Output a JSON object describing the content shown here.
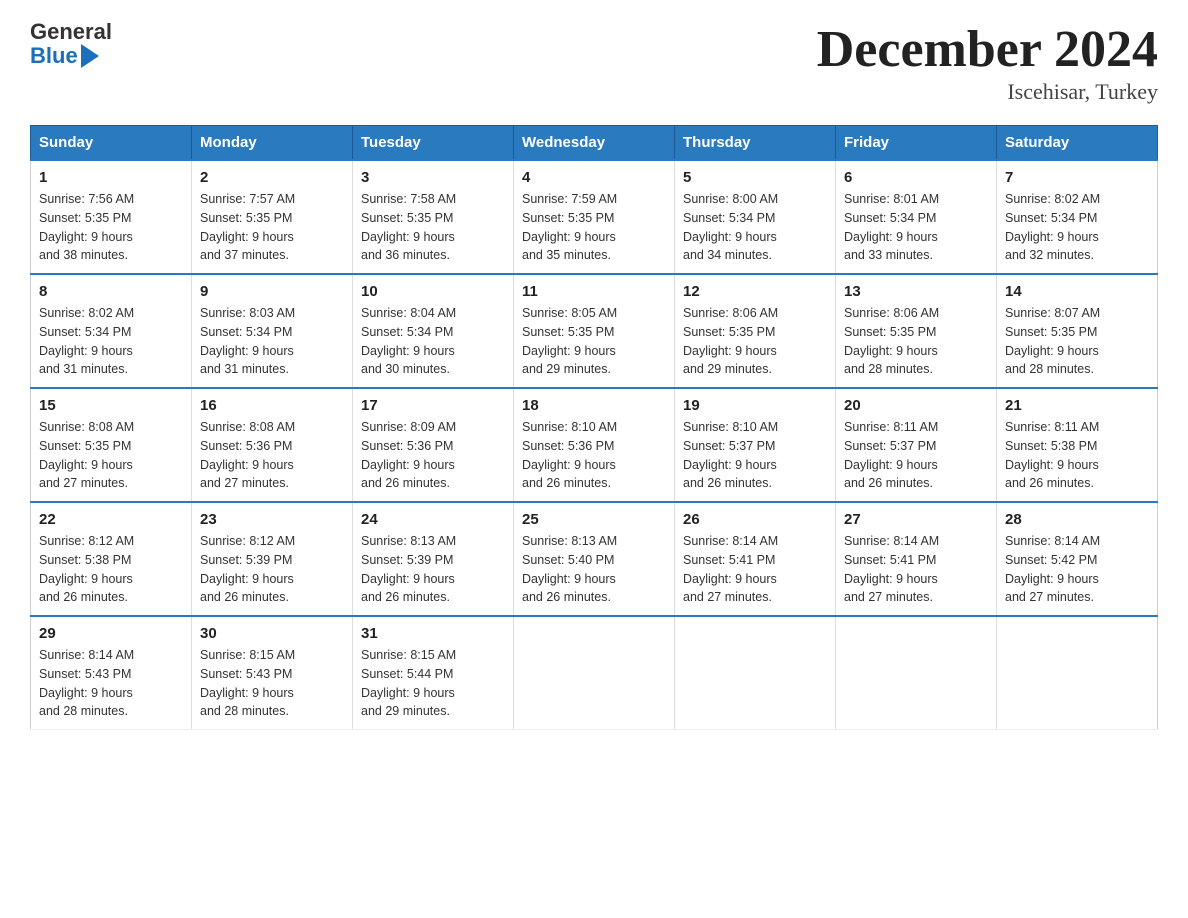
{
  "header": {
    "logo_general": "General",
    "logo_blue": "Blue",
    "month_title": "December 2024",
    "location": "Iscehisar, Turkey"
  },
  "days_of_week": [
    "Sunday",
    "Monday",
    "Tuesday",
    "Wednesday",
    "Thursday",
    "Friday",
    "Saturday"
  ],
  "weeks": [
    [
      {
        "day": "1",
        "sunrise": "7:56 AM",
        "sunset": "5:35 PM",
        "daylight": "9 hours and 38 minutes."
      },
      {
        "day": "2",
        "sunrise": "7:57 AM",
        "sunset": "5:35 PM",
        "daylight": "9 hours and 37 minutes."
      },
      {
        "day": "3",
        "sunrise": "7:58 AM",
        "sunset": "5:35 PM",
        "daylight": "9 hours and 36 minutes."
      },
      {
        "day": "4",
        "sunrise": "7:59 AM",
        "sunset": "5:35 PM",
        "daylight": "9 hours and 35 minutes."
      },
      {
        "day": "5",
        "sunrise": "8:00 AM",
        "sunset": "5:34 PM",
        "daylight": "9 hours and 34 minutes."
      },
      {
        "day": "6",
        "sunrise": "8:01 AM",
        "sunset": "5:34 PM",
        "daylight": "9 hours and 33 minutes."
      },
      {
        "day": "7",
        "sunrise": "8:02 AM",
        "sunset": "5:34 PM",
        "daylight": "9 hours and 32 minutes."
      }
    ],
    [
      {
        "day": "8",
        "sunrise": "8:02 AM",
        "sunset": "5:34 PM",
        "daylight": "9 hours and 31 minutes."
      },
      {
        "day": "9",
        "sunrise": "8:03 AM",
        "sunset": "5:34 PM",
        "daylight": "9 hours and 31 minutes."
      },
      {
        "day": "10",
        "sunrise": "8:04 AM",
        "sunset": "5:34 PM",
        "daylight": "9 hours and 30 minutes."
      },
      {
        "day": "11",
        "sunrise": "8:05 AM",
        "sunset": "5:35 PM",
        "daylight": "9 hours and 29 minutes."
      },
      {
        "day": "12",
        "sunrise": "8:06 AM",
        "sunset": "5:35 PM",
        "daylight": "9 hours and 29 minutes."
      },
      {
        "day": "13",
        "sunrise": "8:06 AM",
        "sunset": "5:35 PM",
        "daylight": "9 hours and 28 minutes."
      },
      {
        "day": "14",
        "sunrise": "8:07 AM",
        "sunset": "5:35 PM",
        "daylight": "9 hours and 28 minutes."
      }
    ],
    [
      {
        "day": "15",
        "sunrise": "8:08 AM",
        "sunset": "5:35 PM",
        "daylight": "9 hours and 27 minutes."
      },
      {
        "day": "16",
        "sunrise": "8:08 AM",
        "sunset": "5:36 PM",
        "daylight": "9 hours and 27 minutes."
      },
      {
        "day": "17",
        "sunrise": "8:09 AM",
        "sunset": "5:36 PM",
        "daylight": "9 hours and 26 minutes."
      },
      {
        "day": "18",
        "sunrise": "8:10 AM",
        "sunset": "5:36 PM",
        "daylight": "9 hours and 26 minutes."
      },
      {
        "day": "19",
        "sunrise": "8:10 AM",
        "sunset": "5:37 PM",
        "daylight": "9 hours and 26 minutes."
      },
      {
        "day": "20",
        "sunrise": "8:11 AM",
        "sunset": "5:37 PM",
        "daylight": "9 hours and 26 minutes."
      },
      {
        "day": "21",
        "sunrise": "8:11 AM",
        "sunset": "5:38 PM",
        "daylight": "9 hours and 26 minutes."
      }
    ],
    [
      {
        "day": "22",
        "sunrise": "8:12 AM",
        "sunset": "5:38 PM",
        "daylight": "9 hours and 26 minutes."
      },
      {
        "day": "23",
        "sunrise": "8:12 AM",
        "sunset": "5:39 PM",
        "daylight": "9 hours and 26 minutes."
      },
      {
        "day": "24",
        "sunrise": "8:13 AM",
        "sunset": "5:39 PM",
        "daylight": "9 hours and 26 minutes."
      },
      {
        "day": "25",
        "sunrise": "8:13 AM",
        "sunset": "5:40 PM",
        "daylight": "9 hours and 26 minutes."
      },
      {
        "day": "26",
        "sunrise": "8:14 AM",
        "sunset": "5:41 PM",
        "daylight": "9 hours and 27 minutes."
      },
      {
        "day": "27",
        "sunrise": "8:14 AM",
        "sunset": "5:41 PM",
        "daylight": "9 hours and 27 minutes."
      },
      {
        "day": "28",
        "sunrise": "8:14 AM",
        "sunset": "5:42 PM",
        "daylight": "9 hours and 27 minutes."
      }
    ],
    [
      {
        "day": "29",
        "sunrise": "8:14 AM",
        "sunset": "5:43 PM",
        "daylight": "9 hours and 28 minutes."
      },
      {
        "day": "30",
        "sunrise": "8:15 AM",
        "sunset": "5:43 PM",
        "daylight": "9 hours and 28 minutes."
      },
      {
        "day": "31",
        "sunrise": "8:15 AM",
        "sunset": "5:44 PM",
        "daylight": "9 hours and 29 minutes."
      },
      null,
      null,
      null,
      null
    ]
  ],
  "labels": {
    "sunrise": "Sunrise:",
    "sunset": "Sunset:",
    "daylight": "Daylight:"
  }
}
